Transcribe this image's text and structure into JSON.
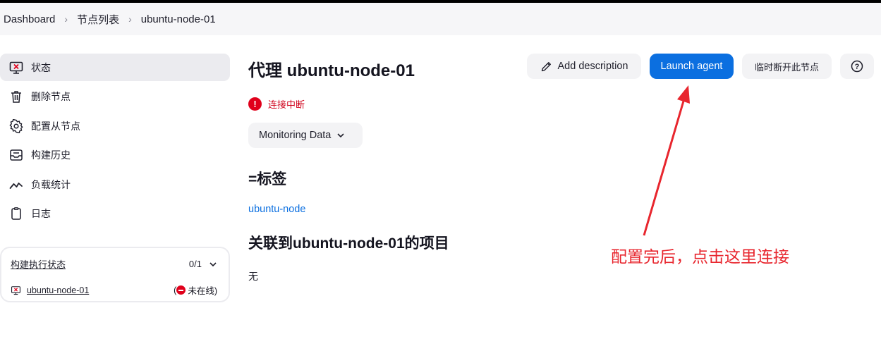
{
  "breadcrumb": {
    "items": [
      "Dashboard",
      "节点列表",
      "ubuntu-node-01"
    ]
  },
  "sidebar": {
    "items": [
      {
        "label": "状态",
        "icon": "computer-error-icon",
        "active": true
      },
      {
        "label": "删除节点",
        "icon": "trash-icon"
      },
      {
        "label": "配置从节点",
        "icon": "gear-icon"
      },
      {
        "label": "构建历史",
        "icon": "inbox-icon"
      },
      {
        "label": "负载统计",
        "icon": "trend-line-icon"
      },
      {
        "label": "日志",
        "icon": "clipboard-icon"
      }
    ]
  },
  "executor": {
    "title": "构建执行状态",
    "count": "0/1",
    "node_name": "ubuntu-node-01",
    "status_prefix": "(",
    "status": "未在线)"
  },
  "main": {
    "title": "代理 ubuntu-node-01",
    "buttons": {
      "add_description": "Add description",
      "launch_agent": "Launch agent",
      "disconnect": "临时断开此节点",
      "help": "?"
    },
    "status_text": "连接中断",
    "monitoring_label": "Monitoring Data",
    "labels_heading": "=标签",
    "label_link": "ubuntu-node",
    "projects_heading": "关联到ubuntu-node-01的项目",
    "projects_none": "无"
  },
  "annotation": {
    "text": "配置完后，点击这里连接",
    "color": "#e8262e"
  },
  "colors": {
    "primary": "#0b6fe0",
    "error": "#e0001b",
    "active_bg": "#ebebef"
  }
}
